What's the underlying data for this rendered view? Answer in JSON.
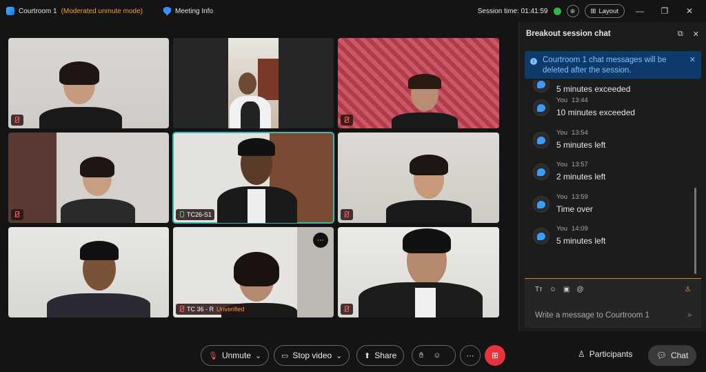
{
  "titlebar": {
    "room_name": "Courtroom 1",
    "mode": "(Moderated unmute mode)",
    "meeting_info": "Meeting Info",
    "session_time": "Session time: 01:41:59",
    "layout_label": "Layout"
  },
  "tiles": [
    {
      "label": "",
      "muted": true
    },
    {
      "label": "",
      "muted": false
    },
    {
      "label": "",
      "muted": true
    },
    {
      "label": "",
      "muted": true
    },
    {
      "label": "TC26-S1",
      "muted": false
    },
    {
      "label": "",
      "muted": true
    },
    {
      "label": "",
      "muted": false
    },
    {
      "label": "TC 36 - R",
      "unverified": "Unverified",
      "muted": true
    },
    {
      "label": "",
      "muted": true
    }
  ],
  "chat_panel": {
    "title": "Breakout session chat",
    "notice": "Courtroom 1 chat messages will be deleted after the session.",
    "messages": [
      {
        "sender": "",
        "time": "",
        "text": "5 minutes exceeded"
      },
      {
        "sender": "You",
        "time": "13:44",
        "text": "10 minutes exceeded"
      },
      {
        "sender": "You",
        "time": "13:54",
        "text": "5 minutes left"
      },
      {
        "sender": "You",
        "time": "13:57",
        "text": "2 minutes left"
      },
      {
        "sender": "You",
        "time": "13:59",
        "text": "Time over"
      },
      {
        "sender": "You",
        "time": "14:09",
        "text": "5 minutes left"
      }
    ],
    "compose_placeholder": "Write a message to Courtroom 1"
  },
  "controls": {
    "unmute": "Unmute",
    "stop_video": "Stop video",
    "share": "Share",
    "participants": "Participants",
    "chat": "Chat"
  },
  "colors": {
    "mode_orange": "#f0a030",
    "active_tile_border": "#37b8b0",
    "end_button": "#e8333a",
    "notice_bg": "#0e3a6a"
  }
}
